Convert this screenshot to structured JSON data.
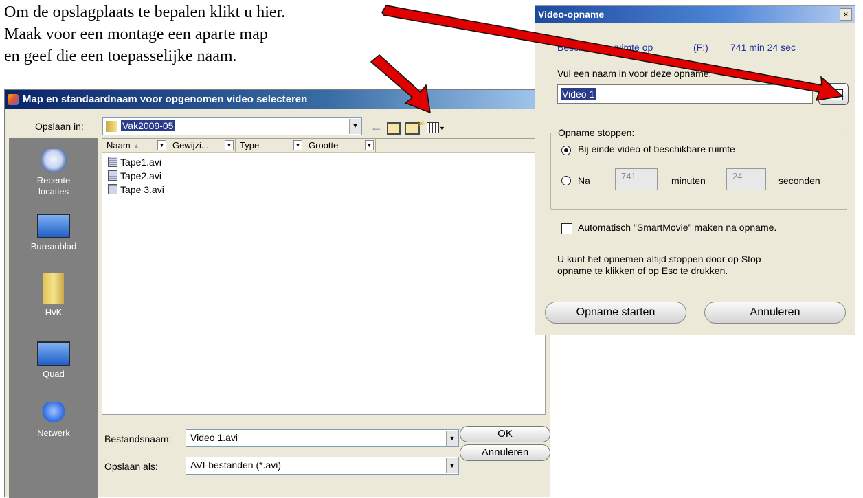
{
  "annotation": {
    "line1": "Om de opslagplaats te bepalen klikt u hier.",
    "line2": "Maak voor een montage een aparte map",
    "line3": "en geef die een toepasselijke naam."
  },
  "file_dialog": {
    "title": "Map en standaardnaam voor opgenomen video selecteren",
    "save_in_label": "Opslaan in:",
    "save_in_value": "Vak2009-05",
    "places": [
      {
        "label": "Recente\nlocaties",
        "label_a": "Recente",
        "label_b": "locaties",
        "icon": "recent-places-icon"
      },
      {
        "label": "Bureaublad",
        "icon": "desktop-icon"
      },
      {
        "label": "HvK",
        "icon": "folder-icon"
      },
      {
        "label": "Quad",
        "icon": "monitor-icon"
      },
      {
        "label": "Netwerk",
        "icon": "network-icon"
      }
    ],
    "columns": [
      "Naam",
      "Gewijzi...",
      "Type",
      "Grootte"
    ],
    "files": [
      "Tape1.avi",
      "Tape2.avi",
      "Tape 3.avi"
    ],
    "filename_label": "Bestandsnaam:",
    "filename_value": "Video 1.avi",
    "saveas_label": "Opslaan als:",
    "saveas_value": "AVI-bestanden (*.avi)",
    "ok_label": "OK",
    "cancel_label": "Annuleren"
  },
  "video_dialog": {
    "title": "Video-opname",
    "close": "×",
    "space_label": "Beschikbare ruimte op",
    "drive": "(F:)",
    "space_value": "741 min 24 sec",
    "name_prompt": "Vul een naam in voor deze opname:",
    "name_value": "Video 1",
    "stop_group": "Opname stoppen:",
    "opt_end": "Bij einde video of beschikbare ruimte",
    "opt_after": "Na",
    "minutes_value": "741",
    "minutes_label": "minuten",
    "seconds_value": "24",
    "seconds_label": "seconden",
    "smartmovie": "Automatisch \"SmartMovie\" maken na opname.",
    "help_line1": "U kunt het opnemen altijd stoppen door op Stop",
    "help_line2": "opname te klikken of op Esc te drukken.",
    "start_label": "Opname starten",
    "cancel_label": "Annuleren"
  },
  "colors": {
    "arrow": "#e00000",
    "dialog_bg": "#ece9d8",
    "places_bar": "#808080",
    "titlebar": "#0a246a"
  }
}
